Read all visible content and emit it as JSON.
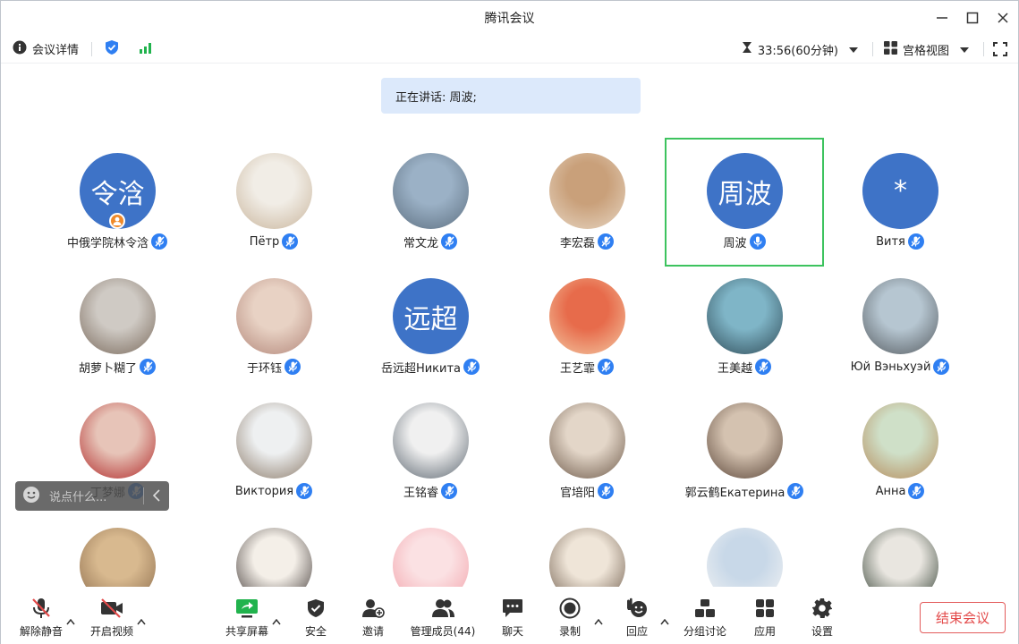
{
  "window": {
    "title": "腾讯会议"
  },
  "infobar": {
    "meeting_details": "会议详情",
    "timer": "33:56(60分钟)",
    "view_mode": "宫格视图"
  },
  "speaking": {
    "text": "正在讲话: 周波;"
  },
  "participants": [
    {
      "name": "中俄学院林令浛",
      "avatar_text": "令浛",
      "host": true
    },
    {
      "name": "Пётр"
    },
    {
      "name": "常文龙"
    },
    {
      "name": "李宏磊"
    },
    {
      "name": "周波",
      "avatar_text": "周波",
      "speaking": true
    },
    {
      "name": "Витя",
      "avatar_text": "*"
    },
    {
      "name": "胡萝卜糊了"
    },
    {
      "name": "于环钰"
    },
    {
      "name": "岳远超Никита",
      "avatar_text": "远超"
    },
    {
      "name": "王艺霏"
    },
    {
      "name": "王美越"
    },
    {
      "name": "Юй Вэньхуэй"
    },
    {
      "name": "丁梦娜"
    },
    {
      "name": "Виктория"
    },
    {
      "name": "王铭睿"
    },
    {
      "name": "官培阳"
    },
    {
      "name": "郭云鹤Екатерина"
    },
    {
      "name": "Анна"
    },
    {
      "name": ""
    },
    {
      "name": ""
    },
    {
      "name": ""
    },
    {
      "name": ""
    },
    {
      "name": ""
    },
    {
      "name": ""
    }
  ],
  "chat": {
    "placeholder": "说点什么..."
  },
  "toolbar": {
    "unmute": "解除静音",
    "start_video": "开启视频",
    "share_screen": "共享屏幕",
    "security": "安全",
    "invite": "邀请",
    "manage_members": "管理成员(44)",
    "chat": "聊天",
    "record": "录制",
    "reactions": "回应",
    "breakout": "分组讨论",
    "apps": "应用",
    "settings": "设置",
    "end_meeting": "结束会议"
  },
  "colors": {
    "accent_blue": "#2f7ff2",
    "avatar_blue": "#3e73c7",
    "speaking_green": "#3dc35e",
    "end_red": "#e34a4a",
    "banner_bg": "#dce9fb"
  }
}
